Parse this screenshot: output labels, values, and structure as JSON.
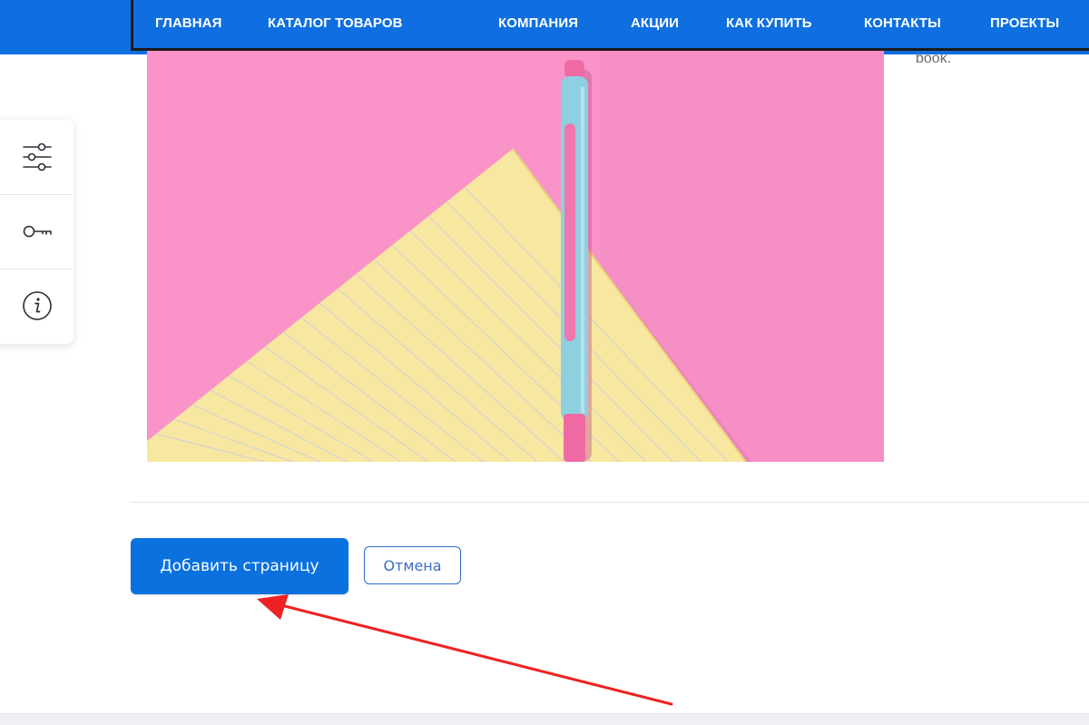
{
  "nav": {
    "items": [
      {
        "label": "ГЛАВНАЯ"
      },
      {
        "label": "КАТАЛОГ ТОВАРОВ"
      },
      {
        "label": "КОМПАНИЯ"
      },
      {
        "label": "АКЦИИ"
      },
      {
        "label": "КАК КУПИТЬ"
      },
      {
        "label": "КОНТАКТЫ"
      },
      {
        "label": "ПРОЕКТЫ"
      }
    ]
  },
  "side_text": "book.",
  "toolbar": {
    "items": [
      {
        "icon": "sliders-icon"
      },
      {
        "icon": "key-icon"
      },
      {
        "icon": "info-icon"
      }
    ]
  },
  "actions": {
    "add_page_label": "Добавить страницу",
    "cancel_label": "Отмена"
  },
  "colors": {
    "nav_bg": "#0f6fe0",
    "primary_button": "#0a71de",
    "annotation_arrow": "#ee2222",
    "image_pink": "#f993c8",
    "image_paper": "#f7e7a0",
    "pen_blue": "#8ed0e0"
  }
}
